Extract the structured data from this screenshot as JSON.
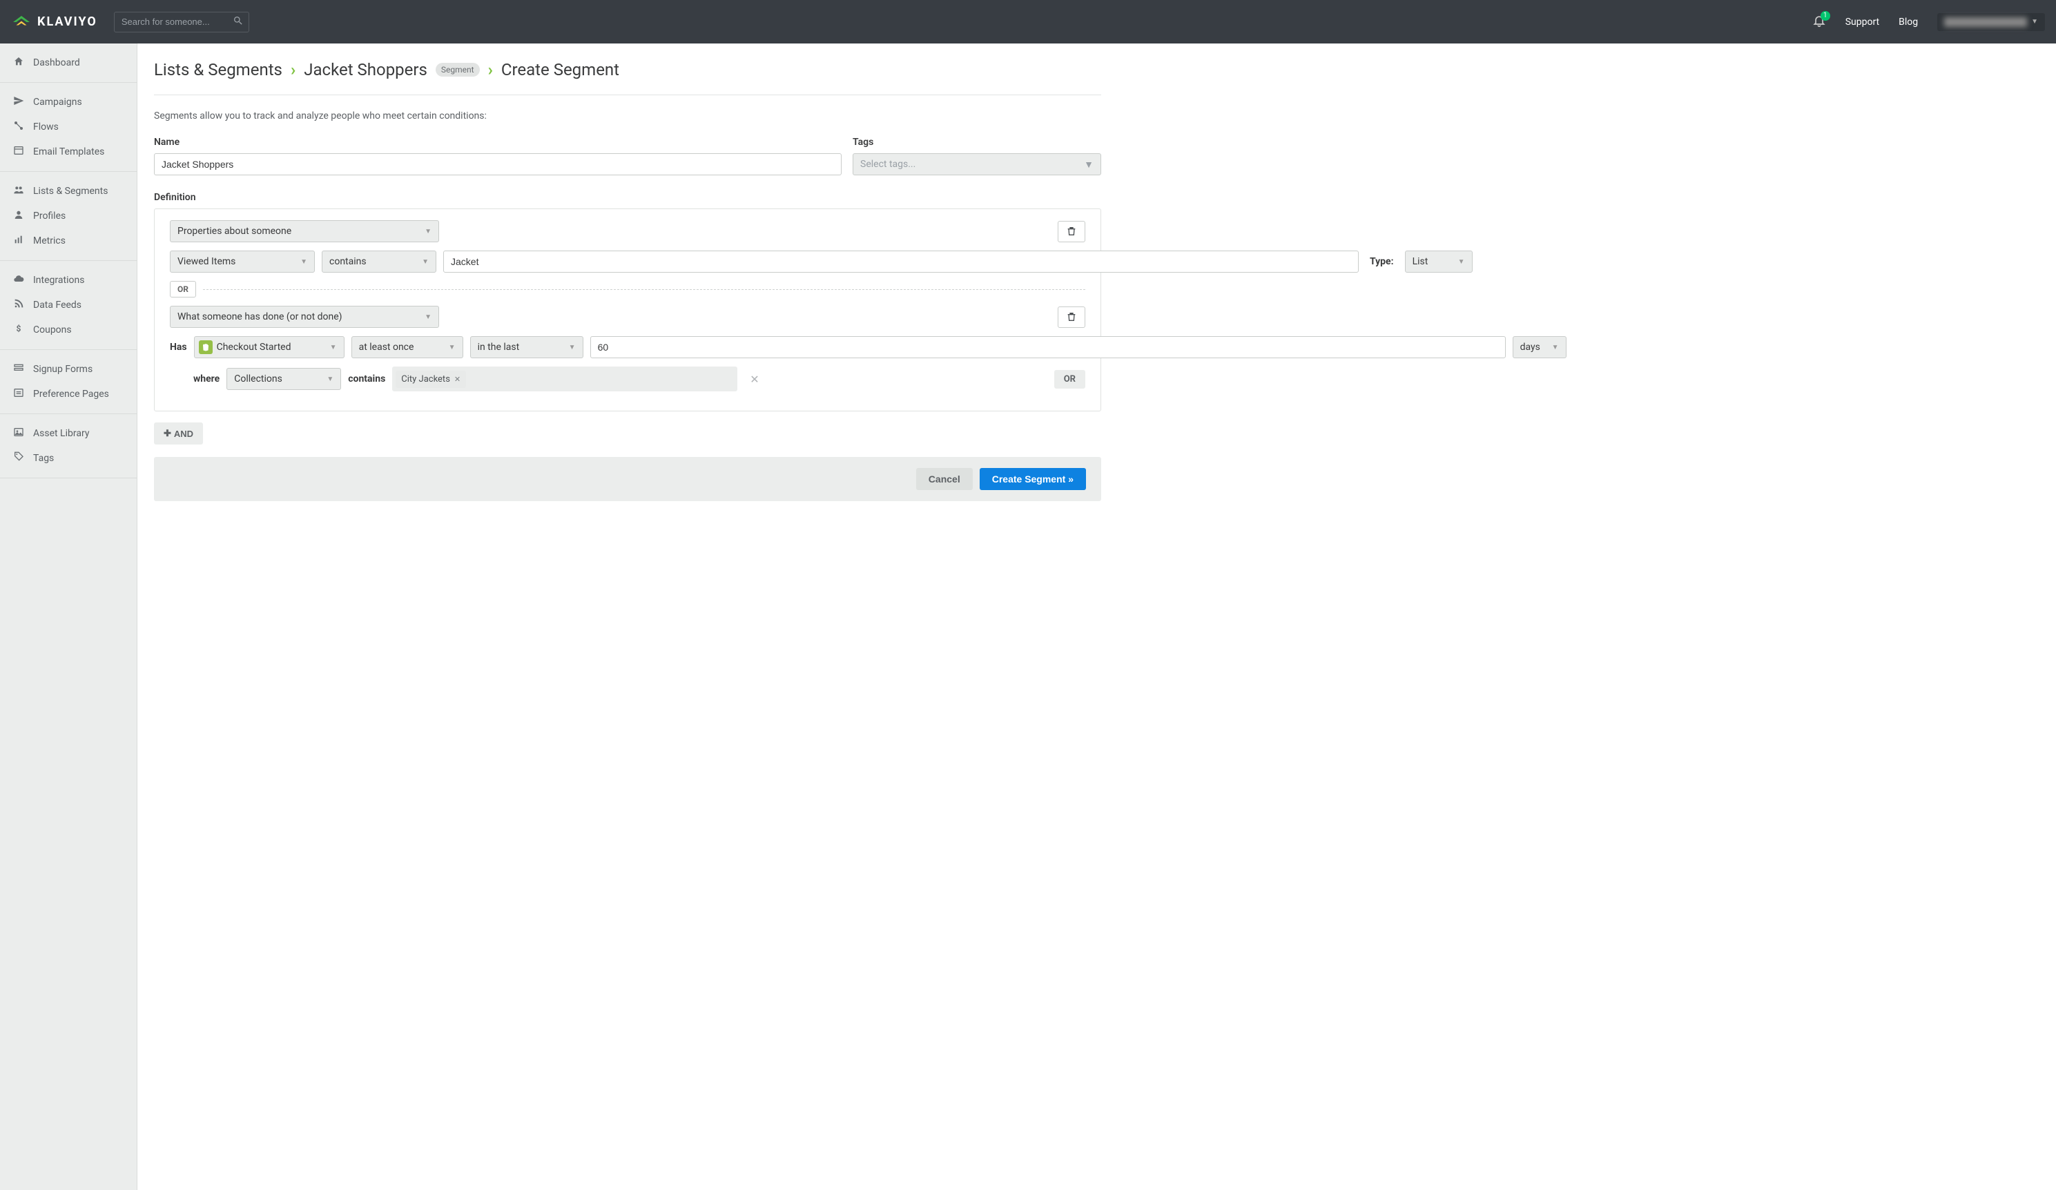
{
  "header": {
    "brand": "KLAVIYO",
    "search_placeholder": "Search for someone...",
    "notification_count": "1",
    "support": "Support",
    "blog": "Blog"
  },
  "sidebar": {
    "groups": [
      {
        "items": [
          {
            "label": "Dashboard",
            "icon": "home"
          }
        ]
      },
      {
        "items": [
          {
            "label": "Campaigns",
            "icon": "send"
          },
          {
            "label": "Flows",
            "icon": "flow"
          },
          {
            "label": "Email Templates",
            "icon": "template"
          }
        ]
      },
      {
        "items": [
          {
            "label": "Lists & Segments",
            "icon": "users"
          },
          {
            "label": "Profiles",
            "icon": "user"
          },
          {
            "label": "Metrics",
            "icon": "chart"
          }
        ]
      },
      {
        "items": [
          {
            "label": "Integrations",
            "icon": "cloud"
          },
          {
            "label": "Data Feeds",
            "icon": "rss"
          },
          {
            "label": "Coupons",
            "icon": "dollar"
          }
        ]
      },
      {
        "items": [
          {
            "label": "Signup Forms",
            "icon": "form"
          },
          {
            "label": "Preference Pages",
            "icon": "pref"
          }
        ]
      },
      {
        "items": [
          {
            "label": "Asset Library",
            "icon": "image"
          },
          {
            "label": "Tags",
            "icon": "tag"
          }
        ]
      }
    ]
  },
  "breadcrumb": {
    "root": "Lists & Segments",
    "parent": "Jacket Shoppers",
    "chip": "Segment",
    "current": "Create Segment"
  },
  "description": "Segments allow you to track and analyze people who meet certain conditions:",
  "name_label": "Name",
  "name_value": "Jacket Shoppers",
  "tags_label": "Tags",
  "tags_placeholder": "Select tags...",
  "definition_label": "Definition",
  "condition1": {
    "type_select": "Properties about someone",
    "property": "Viewed Items",
    "dimension": "contains",
    "value": "Jacket",
    "type_label": "Type:",
    "type_value": "List"
  },
  "or_label": "OR",
  "condition2": {
    "type_select": "What someone has done (or not done)",
    "has_label": "Has",
    "event": "Checkout Started",
    "frequency": "at least once",
    "timerange": "in the last",
    "number": "60",
    "unit": "days",
    "where_label": "where",
    "where_field": "Collections",
    "contains_label": "contains",
    "where_value": "City Jackets"
  },
  "and_label": "AND",
  "footer": {
    "cancel": "Cancel",
    "submit": "Create Segment »"
  }
}
